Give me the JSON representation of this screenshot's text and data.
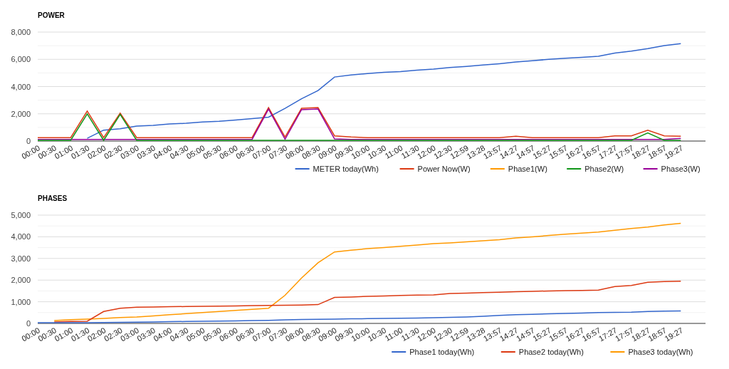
{
  "charts": [
    {
      "chart_data": {
        "type": "line",
        "title": "POWER",
        "grid": true,
        "legend": "bottom-right",
        "categories": [
          "00:00",
          "00:30",
          "01:00",
          "01:30",
          "02:00",
          "02:30",
          "03:00",
          "03:30",
          "04:00",
          "04:30",
          "05:00",
          "05:30",
          "06:00",
          "06:30",
          "07:00",
          "07:30",
          "08:00",
          "08:30",
          "09:00",
          "09:30",
          "10:00",
          "10:30",
          "11:00",
          "11:30",
          "12:00",
          "12:30",
          "12:59",
          "13:28",
          "13:57",
          "14:27",
          "14:57",
          "15:27",
          "15:57",
          "16:27",
          "16:57",
          "17:27",
          "17:57",
          "18:27",
          "18:57",
          "19:27"
        ],
        "ylim": [
          0,
          8000
        ],
        "yticks": [
          {
            "value": 0,
            "label": "0"
          },
          {
            "value": 2000,
            "label": "2,000"
          },
          {
            "value": 4000,
            "label": "4,000"
          },
          {
            "value": 6000,
            "label": "6,000"
          },
          {
            "value": 8000,
            "label": "8,000"
          }
        ],
        "series": [
          {
            "name": "METER today(Wh)",
            "color": "#3366cc",
            "values": [
              null,
              null,
              null,
              200,
              800,
              900,
              1100,
              1150,
              1250,
              1300,
              1400,
              1450,
              1550,
              1650,
              1750,
              2400,
              3100,
              3700,
              4700,
              4850,
              4950,
              5050,
              5100,
              5200,
              5280,
              5400,
              5480,
              5580,
              5680,
              5800,
              5900,
              6000,
              6080,
              6150,
              6230,
              6450,
              6600,
              6780,
              7000,
              7150
            ]
          },
          {
            "name": "Power Now(W)",
            "color": "#dc3912",
            "values": [
              250,
              250,
              250,
              2200,
              250,
              2050,
              250,
              250,
              250,
              250,
              250,
              250,
              250,
              250,
              2450,
              300,
              2400,
              2450,
              380,
              300,
              250,
              250,
              250,
              250,
              250,
              250,
              250,
              250,
              250,
              350,
              250,
              250,
              250,
              250,
              250,
              380,
              380,
              800,
              380,
              350
            ]
          },
          {
            "name": "Phase1(W)",
            "color": "#ff9900",
            "values": [
              null,
              null,
              null,
              null,
              null,
              null,
              null,
              null,
              null,
              null,
              null,
              null,
              null,
              null,
              null,
              null,
              null,
              null,
              null,
              null,
              null,
              null,
              null,
              null,
              null,
              null,
              null,
              null,
              null,
              null,
              null,
              null,
              null,
              null,
              null,
              null,
              null,
              null,
              null,
              null
            ]
          },
          {
            "name": "Phase2(W)",
            "color": "#109618",
            "values": [
              0,
              0,
              0,
              2000,
              0,
              1950,
              0,
              0,
              0,
              0,
              0,
              0,
              0,
              0,
              0,
              0,
              0,
              0,
              0,
              0,
              0,
              0,
              0,
              0,
              0,
              0,
              0,
              0,
              0,
              0,
              0,
              0,
              0,
              0,
              0,
              0,
              0,
              600,
              0,
              0
            ]
          },
          {
            "name": "Phase3(W)",
            "color": "#990099",
            "values": [
              120,
              120,
              120,
              120,
              120,
              120,
              120,
              120,
              120,
              120,
              120,
              120,
              120,
              120,
              2350,
              130,
              2300,
              2350,
              150,
              120,
              120,
              120,
              120,
              120,
              120,
              120,
              120,
              120,
              120,
              120,
              120,
              120,
              120,
              120,
              120,
              120,
              120,
              120,
              120,
              200
            ]
          }
        ]
      }
    },
    {
      "chart_data": {
        "type": "line",
        "title": "PHASES",
        "grid": true,
        "legend": "bottom-right",
        "categories": [
          "00:00",
          "00:30",
          "01:00",
          "01:30",
          "02:00",
          "02:30",
          "03:00",
          "03:30",
          "04:00",
          "04:30",
          "05:00",
          "05:30",
          "06:00",
          "06:30",
          "07:00",
          "07:30",
          "08:00",
          "08:30",
          "09:00",
          "09:30",
          "10:00",
          "10:30",
          "11:00",
          "11:30",
          "12:00",
          "12:30",
          "12:59",
          "13:28",
          "13:57",
          "14:27",
          "14:57",
          "15:27",
          "15:57",
          "16:27",
          "16:57",
          "17:27",
          "17:57",
          "18:27",
          "18:57",
          "19:27"
        ],
        "ylim": [
          0,
          5000
        ],
        "yticks": [
          {
            "value": 0,
            "label": "0"
          },
          {
            "value": 1000,
            "label": "1,000"
          },
          {
            "value": 2000,
            "label": "2,000"
          },
          {
            "value": 3000,
            "label": "3,000"
          },
          {
            "value": 4000,
            "label": "4,000"
          },
          {
            "value": 5000,
            "label": "5,000"
          }
        ],
        "series": [
          {
            "name": "Phase1 today(Wh)",
            "color": "#3366cc",
            "values": [
              0,
              10,
              20,
              30,
              40,
              50,
              60,
              70,
              80,
              90,
              100,
              110,
              120,
              130,
              140,
              160,
              180,
              190,
              200,
              210,
              220,
              230,
              240,
              250,
              260,
              280,
              300,
              330,
              370,
              400,
              420,
              440,
              460,
              480,
              500,
              510,
              520,
              550,
              570,
              580
            ]
          },
          {
            "name": "Phase2 today(Wh)",
            "color": "#dc3912",
            "values": [
              null,
              70,
              90,
              100,
              550,
              700,
              750,
              760,
              770,
              780,
              790,
              800,
              810,
              820,
              830,
              840,
              850,
              870,
              1200,
              1220,
              1250,
              1270,
              1290,
              1310,
              1320,
              1380,
              1400,
              1420,
              1440,
              1460,
              1480,
              1500,
              1510,
              1520,
              1540,
              1700,
              1750,
              1900,
              1930,
              1950
            ]
          },
          {
            "name": "Phase3 today(Wh)",
            "color": "#ff9900",
            "values": [
              null,
              130,
              170,
              200,
              230,
              270,
              300,
              350,
              400,
              450,
              500,
              550,
              600,
              650,
              700,
              1300,
              2100,
              2800,
              3300,
              3380,
              3450,
              3500,
              3560,
              3620,
              3680,
              3720,
              3770,
              3820,
              3870,
              3950,
              4000,
              4060,
              4120,
              4170,
              4220,
              4300,
              4380,
              4450,
              4550,
              4620
            ]
          }
        ]
      }
    }
  ]
}
